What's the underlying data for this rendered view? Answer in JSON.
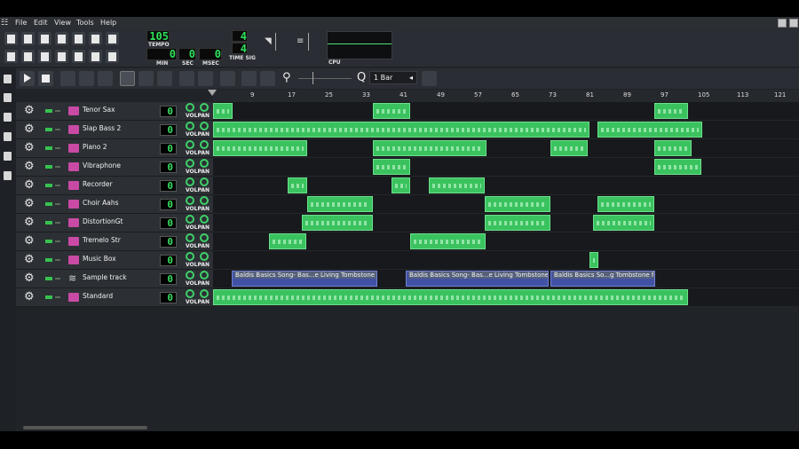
{
  "menu": {
    "file": "File",
    "edit": "Edit",
    "view": "View",
    "tools": "Tools",
    "help": "Help"
  },
  "tempo": {
    "value": "105",
    "label": "TEMPO"
  },
  "time": {
    "min": "0",
    "sec": "0",
    "msec": "0",
    "min_label": "MIN",
    "sec_label": "SEC",
    "msec_label": "MSEC"
  },
  "timesig": {
    "num": "4",
    "den": "4",
    "label": "TIME SIG"
  },
  "cpu_label": "CPU",
  "zoom": "1 Bar",
  "ruler": [
    "9",
    "17",
    "25",
    "33",
    "41",
    "49",
    "57",
    "65",
    "73",
    "81",
    "89",
    "97",
    "105",
    "113",
    "121"
  ],
  "vol_label": "VOL",
  "pan_label": "PAN",
  "tracks": [
    {
      "name": "Tenor Sax",
      "value": "0",
      "type": "instrument"
    },
    {
      "name": "Slap Bass 2",
      "value": "0",
      "type": "instrument"
    },
    {
      "name": "Piano 2",
      "value": "0",
      "type": "instrument"
    },
    {
      "name": "Vibraphone",
      "value": "0",
      "type": "instrument"
    },
    {
      "name": "Recorder",
      "value": "0",
      "type": "instrument"
    },
    {
      "name": "Choir Aahs",
      "value": "0",
      "type": "instrument"
    },
    {
      "name": "DistortionGt",
      "value": "0",
      "type": "instrument"
    },
    {
      "name": "Tremelo Str",
      "value": "0",
      "type": "instrument"
    },
    {
      "name": "Music Box",
      "value": "0",
      "type": "instrument"
    },
    {
      "name": "Sample track",
      "value": "0",
      "type": "sample"
    },
    {
      "name": "Standard",
      "value": "0",
      "type": "instrument"
    }
  ],
  "sample_clips": [
    "Baldis Basics Song- Bas...e Living Tombstone feat.",
    "Baldis Basics Song- Bas...e Living Tombstone feat.",
    "Baldis Basics So...g Tombstone feat."
  ],
  "colors": {
    "clip": "#3ac25f",
    "sample_clip": "#4152a4",
    "lcd": "#2fe05a",
    "accent": "#c84aa5"
  }
}
